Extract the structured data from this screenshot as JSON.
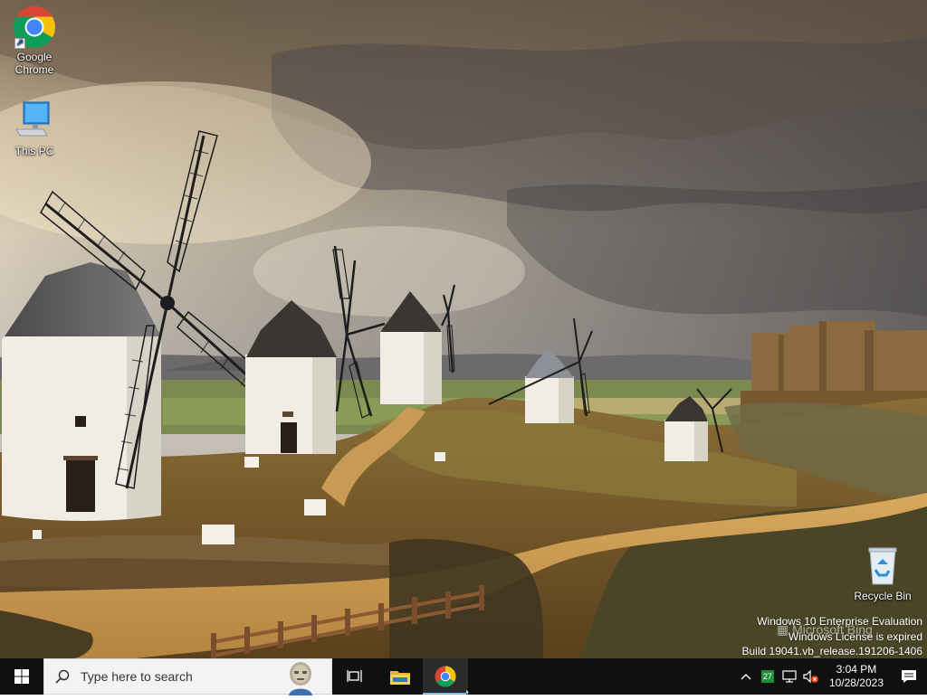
{
  "desktop": {
    "icons": [
      {
        "label": "Google Chrome",
        "icon": "chrome-icon"
      },
      {
        "label": "This PC",
        "icon": "computer-icon"
      },
      {
        "label": "Recycle Bin",
        "icon": "recycle-bin-icon"
      }
    ]
  },
  "watermark": {
    "line1": "Windows 10 Enterprise Evaluation",
    "line2": "Windows License is expired",
    "line3": "Build 19041.vb_release.191206-1406",
    "bing": "Microsoft Bing"
  },
  "taskbar": {
    "search_placeholder": "Type here to search",
    "pinned": [
      {
        "icon": "task-view-icon"
      },
      {
        "icon": "file-explorer-icon"
      },
      {
        "icon": "chrome-icon",
        "active": true
      }
    ],
    "tray": {
      "badge_count": "27",
      "time": "3:04 PM",
      "date": "10/28/2023"
    }
  },
  "colors": {
    "taskbar_bg": "#101010",
    "active_indicator": "#76b9ed",
    "search_bg": "#f3f3f3"
  }
}
